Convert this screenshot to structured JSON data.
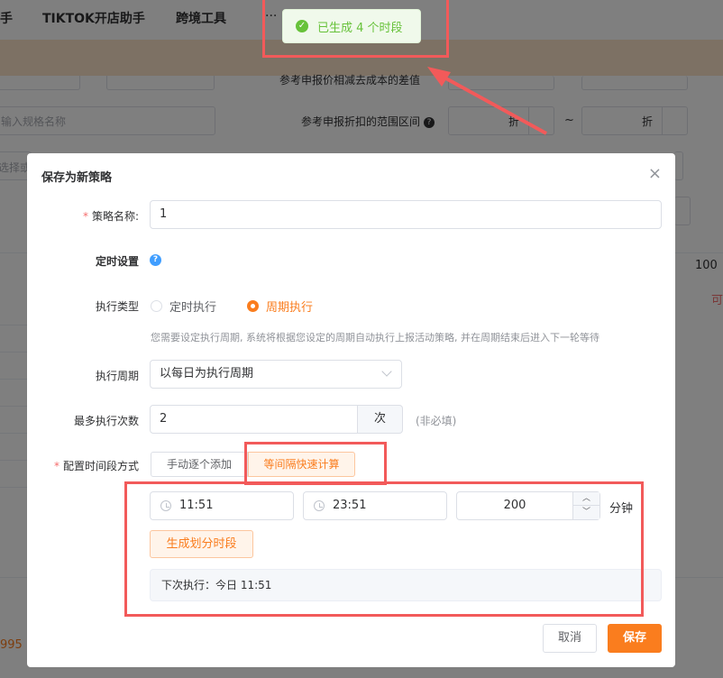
{
  "nav": {
    "item_cut": "手",
    "item_tiktok": "TIKTOK开店助手",
    "item_cross": "跨境工具",
    "item_more": "···"
  },
  "background": {
    "label_diff": "参考申报价相减去成本的差值",
    "label_range": "参考申报折扣的范围区间",
    "spec_placeholder": "输入规格名称",
    "select_placeholder": "选择或",
    "discount_unit_1": "折",
    "discount_unit_2": "折",
    "range_sep": "~",
    "value_100": "100",
    "red_text": "可",
    "footer_num": "995"
  },
  "toast": {
    "message": "已生成 4 个时段",
    "icon": "check-circle"
  },
  "dialog": {
    "title": "保存为新策略",
    "close_symbol": "×",
    "strategy_name": {
      "label": "策略名称:",
      "value": "1"
    },
    "timer_settings": {
      "label": "定时设置"
    },
    "exec_type": {
      "label": "执行类型",
      "options": [
        "定时执行",
        "周期执行"
      ],
      "selected": "周期执行"
    },
    "exec_hint": "您需要设定执行周期, 系统将根据您设定的周期自动执行上报活动策略, 并在周期结束后进入下一轮等待",
    "exec_period": {
      "label": "执行周期",
      "value": "以每日为执行周期"
    },
    "max_exec": {
      "label": "最多执行次数",
      "value": "2",
      "unit": "次",
      "hint": "(非必填)"
    },
    "time_mode": {
      "label": "配置时间段方式",
      "options": [
        "手动逐个添加",
        "等间隔快速计算"
      ],
      "selected": "等间隔快速计算"
    },
    "interval": {
      "start": "11:51",
      "end": "23:51",
      "minutes": "200",
      "minutes_unit": "分钟"
    },
    "generate_button": "生成划分时段",
    "next_exec": "下次执行：今日 11:51",
    "cancel_button": "取消",
    "save_button": "保存"
  },
  "colors": {
    "accent": "#fa7d1e",
    "success": "#67c23a",
    "annotation": "#f25a5a",
    "info": "#409eff"
  }
}
